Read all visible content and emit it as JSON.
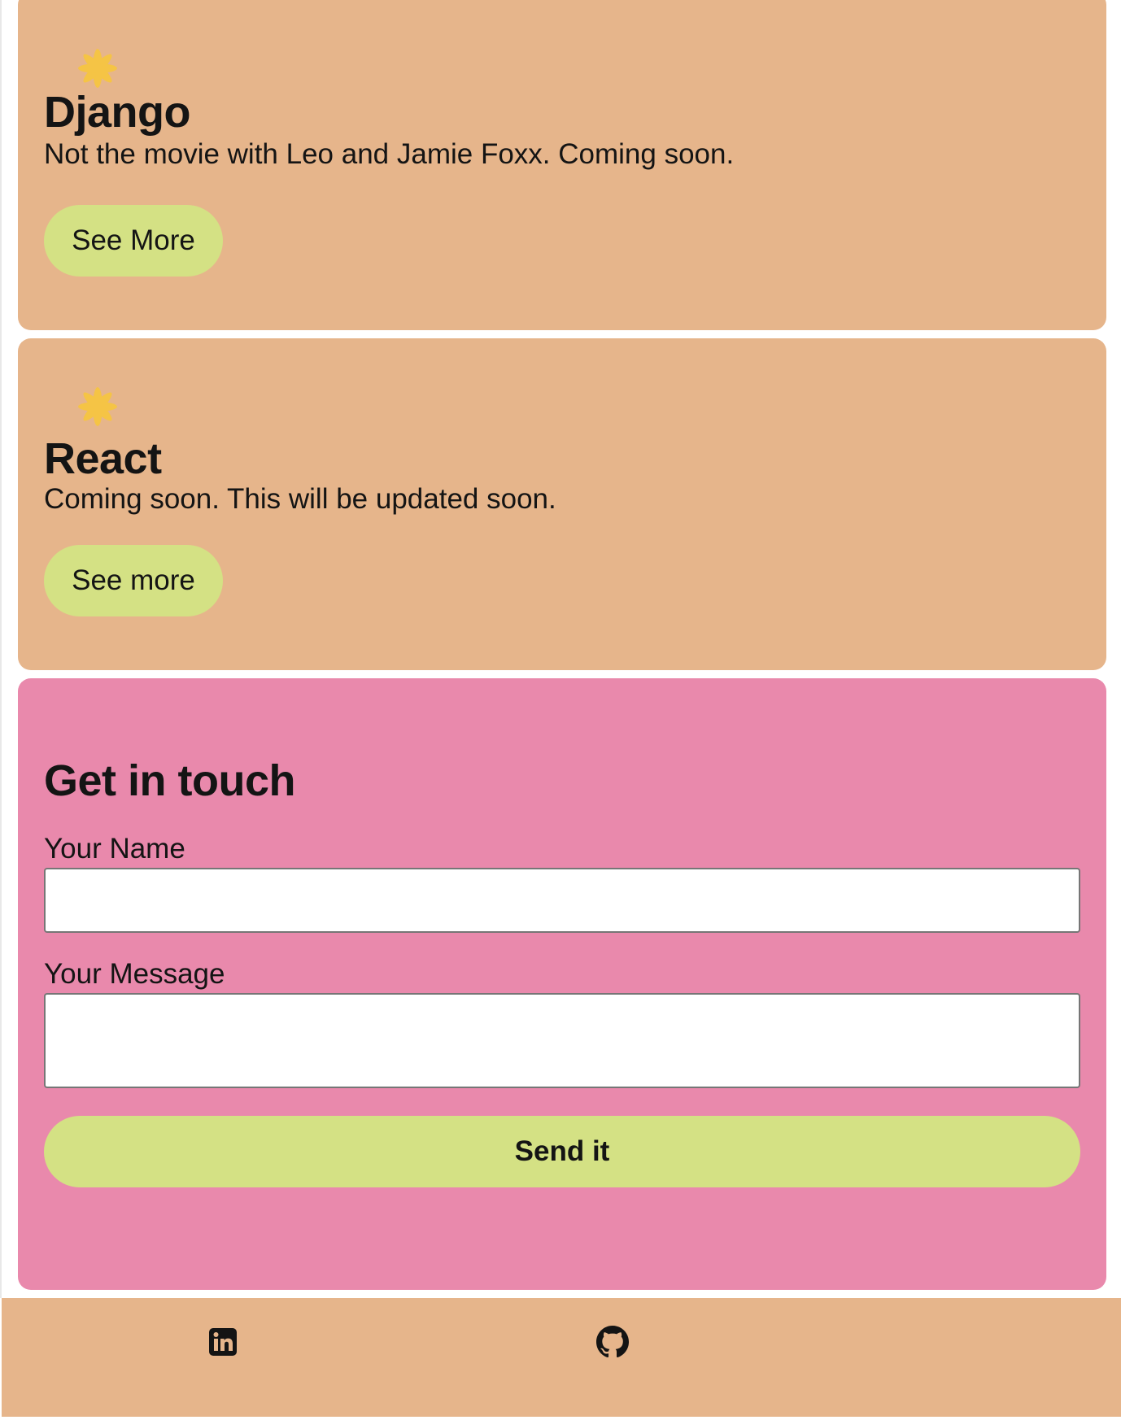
{
  "colors": {
    "project_card": "#e6b58b",
    "contact_card": "#e989ac",
    "button": "#d4e184",
    "spark": "#f5c445",
    "footer": "#e6b58b"
  },
  "projects": [
    {
      "icon": "sparkle-icon",
      "title": "Django",
      "description": "Not the movie with Leo and Jamie Foxx. Coming soon.",
      "button_label": "See More"
    },
    {
      "icon": "sparkle-icon",
      "title": "React",
      "description": "Coming soon. This will be updated soon.",
      "button_label": "See more"
    }
  ],
  "contact": {
    "title": "Get in touch",
    "name_label": "Your Name",
    "name_value": "",
    "message_label": "Your Message",
    "message_value": "",
    "submit_label": "Send it"
  },
  "footer": {
    "links": [
      {
        "icon": "linkedin-icon"
      },
      {
        "icon": "github-icon"
      }
    ]
  }
}
